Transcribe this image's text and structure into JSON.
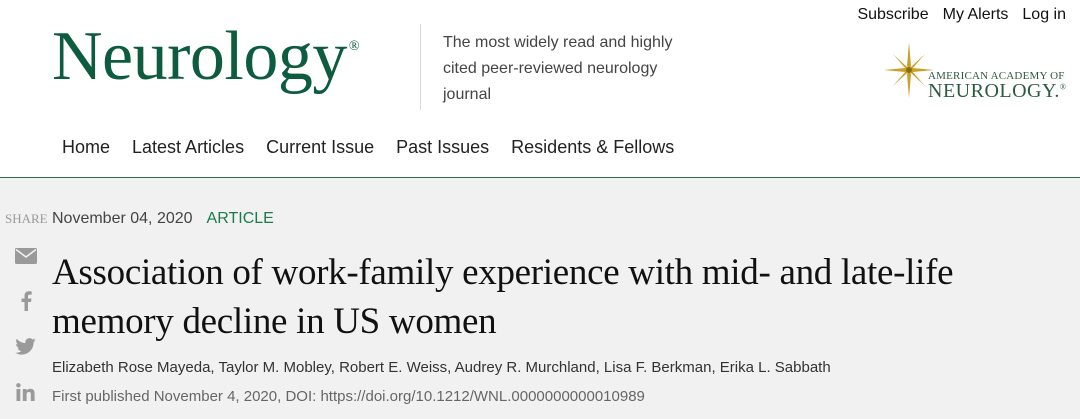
{
  "header": {
    "logo": "Neurology",
    "logo_mark": "®",
    "tagline": "The most widely read and highly cited peer-reviewed neurology journal",
    "top_links": {
      "subscribe": "Subscribe",
      "alerts": "My Alerts",
      "login": "Log in"
    },
    "aan": {
      "line1": "AMERICAN ACADEMY OF",
      "line2": "NEUROLOGY.",
      "mark": "®"
    }
  },
  "nav": {
    "home": "Home",
    "latest": "Latest Articles",
    "current": "Current Issue",
    "past": "Past Issues",
    "residents": "Residents & Fellows"
  },
  "article": {
    "share_label": "SHARE",
    "date": "November 04, 2020",
    "type": "ARTICLE",
    "title": "Association of work-family experience with mid- and late-life memory decline in US women",
    "authors": "Elizabeth Rose Mayeda, Taylor M. Mobley, Robert E. Weiss, Audrey R. Murchland, Lisa F. Berkman, Erika L. Sabbath",
    "published": "First published November 4, 2020, DOI: https://doi.org/10.1212/WNL.0000000000010989"
  },
  "colors": {
    "brand_green": "#0d5c3f",
    "article_type": "#1e7a4b",
    "aan_gold": "#c9a12a"
  },
  "share_icons": [
    "email-icon",
    "facebook-icon",
    "twitter-icon",
    "linkedin-icon"
  ]
}
